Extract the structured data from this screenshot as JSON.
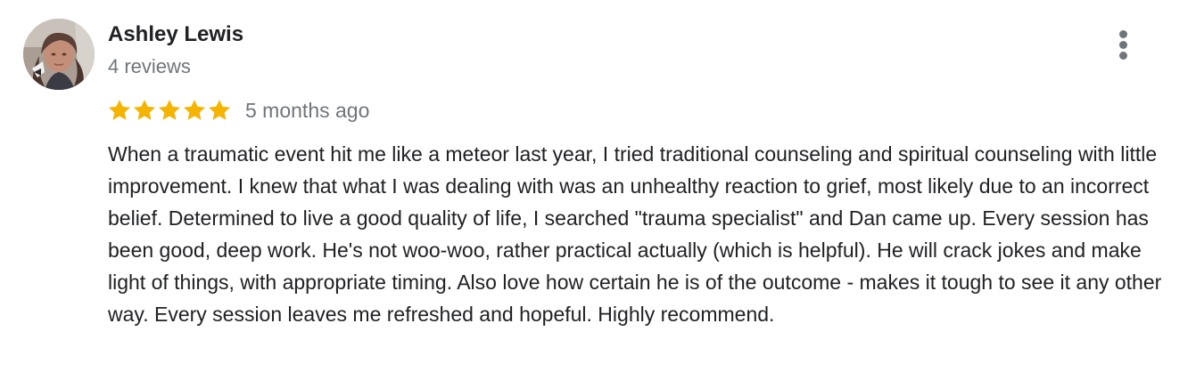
{
  "review": {
    "reviewer_name": "Ashley Lewis",
    "review_count": "4 reviews",
    "rating": 5,
    "rating_max": 5,
    "time_ago": "5 months ago",
    "text": "When a traumatic event hit me like a meteor last year, I tried traditional counseling and spiritual counseling with little improvement. I knew that what I was dealing with was an unhealthy reaction to grief, most likely due to an incorrect belief. Determined to live a good quality of life, I searched \"trauma specialist\" and Dan came up. Every session has been good, deep work. He's not woo-woo, rather practical actually (which is helpful). He will crack jokes and make light of things, with appropriate timing. Also love how certain he is of the outcome - makes it tough to see it any other way. Every session leaves me refreshed and hopeful. Highly recommend.",
    "icons": {
      "avatar": "reviewer-avatar-photo",
      "star": "star-icon",
      "more": "more-vertical-icon"
    }
  },
  "colors": {
    "star": "#f4b400",
    "name": "#202124",
    "secondary": "#70757a",
    "body": "#202124"
  }
}
